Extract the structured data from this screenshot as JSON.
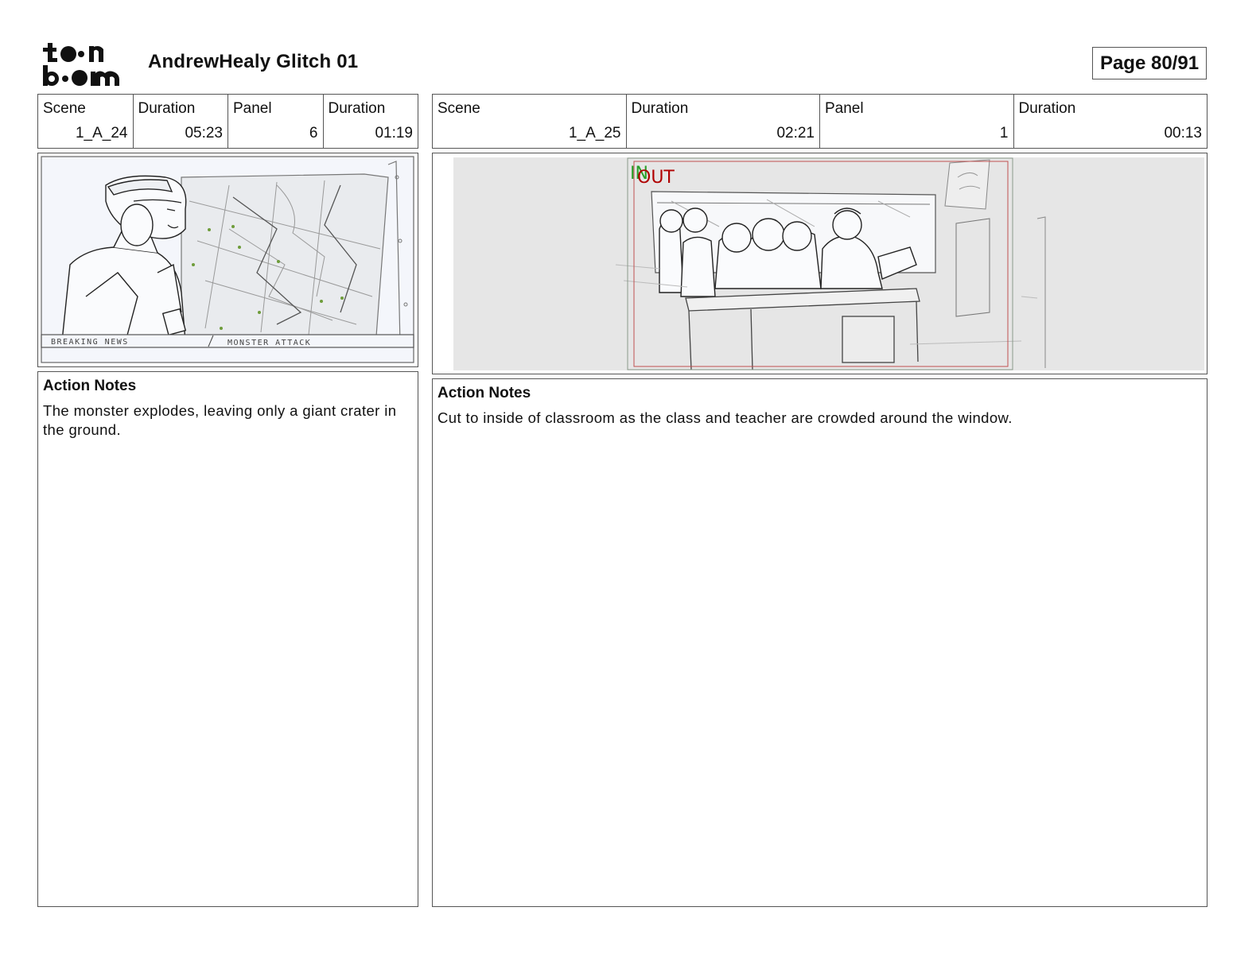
{
  "header": {
    "logo_text": "toon boom",
    "project_title": "AndrewHealy Glitch 01",
    "page_label": "Page 80/91"
  },
  "panels": [
    {
      "scene_label": "Scene",
      "scene_value": "1_A_24",
      "duration_label": "Duration",
      "duration_value": "05:23",
      "panel_label": "Panel",
      "panel_value": "6",
      "panel_duration_label": "Duration",
      "panel_duration_value": "01:19",
      "sketch_text_1": "BREAKING NEWS",
      "sketch_text_2": "MONSTER ATTACK",
      "notes_title": "Action Notes",
      "notes_text": "The monster explodes, leaving only a giant crater in the ground."
    },
    {
      "scene_label": "Scene",
      "scene_value": "1_A_25",
      "duration_label": "Duration",
      "duration_value": "02:21",
      "panel_label": "Panel",
      "panel_value": "1",
      "panel_duration_label": "Duration",
      "panel_duration_value": "00:13",
      "marker_in": "IN",
      "marker_out": "OUT",
      "notes_title": "Action Notes",
      "notes_text": "Cut to inside of classroom as the class and teacher are crowded around the window."
    }
  ]
}
